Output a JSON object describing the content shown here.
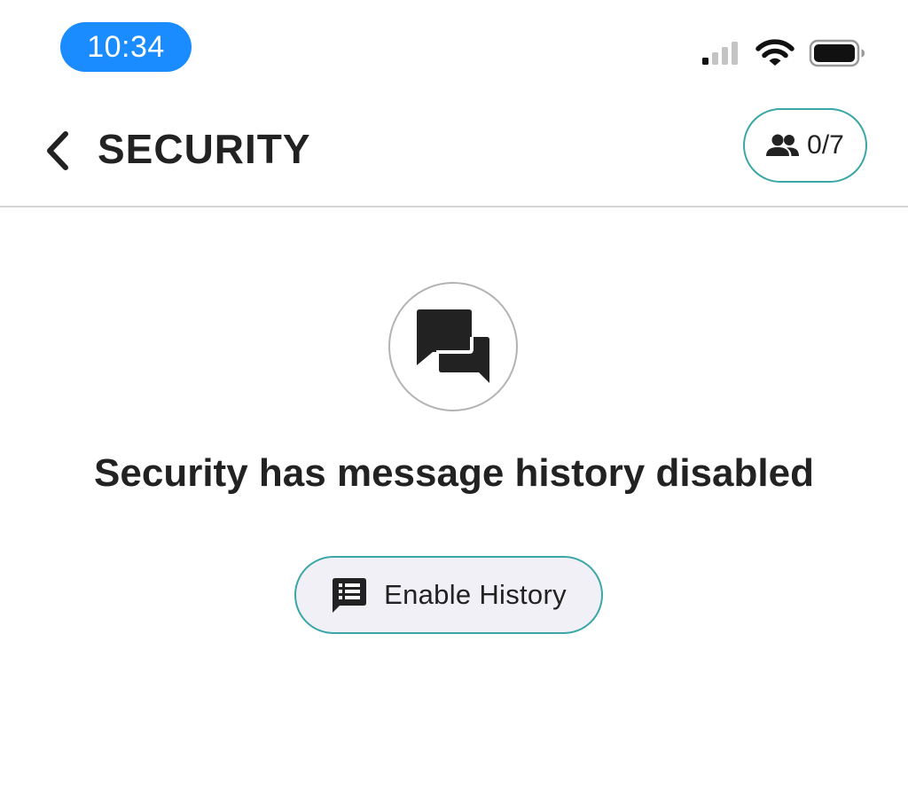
{
  "status_bar": {
    "time": "10:34",
    "icons": [
      "signal-icon",
      "wifi-icon",
      "battery-icon"
    ]
  },
  "header": {
    "back_icon": "chevron-left-icon",
    "title": "SECURITY",
    "members_icon": "people-icon",
    "members_count": "0/7"
  },
  "main": {
    "icon": "chat-bubbles-icon",
    "message": "Security has message history disabled",
    "enable_button": {
      "icon": "list-message-icon",
      "label": "Enable History"
    }
  },
  "colors": {
    "time_pill": "#1a8cff",
    "accent_border": "#3aa6a6",
    "button_fill": "#f0f0f6",
    "text": "#222222",
    "divider": "#d6d6d6"
  }
}
